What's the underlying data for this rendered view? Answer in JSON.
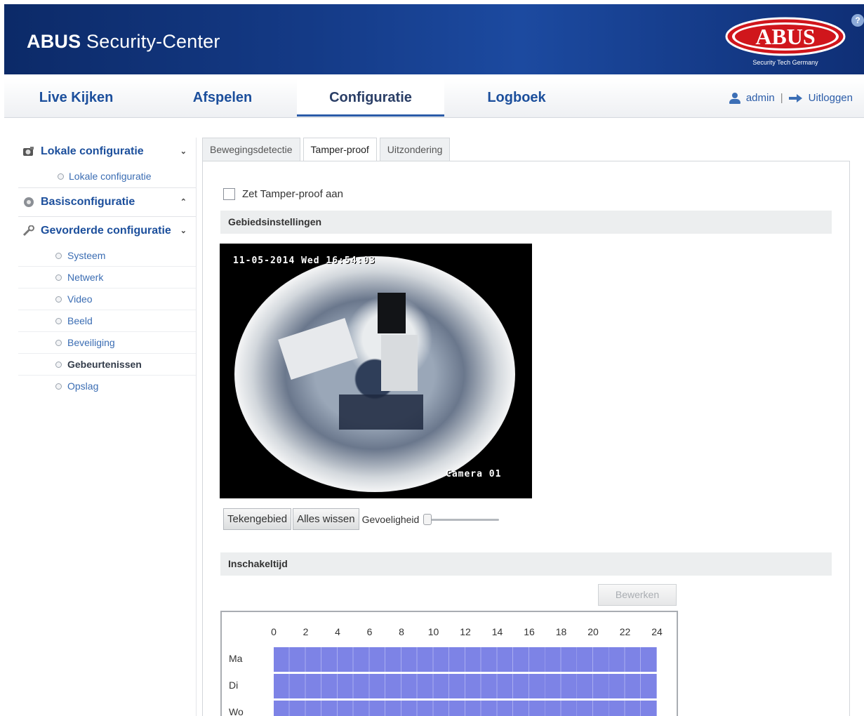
{
  "header": {
    "title_bold": "ABUS",
    "title_rest": " Security-Center",
    "logo_text": "ABUS",
    "logo_tagline": "Security Tech Germany",
    "help_label": "?"
  },
  "nav": {
    "tabs": [
      "Live Kijken",
      "Afspelen",
      "Configuratie",
      "Logboek"
    ],
    "active_tab": "Configuratie",
    "user": "admin",
    "separator": "|",
    "logout": "Uitloggen"
  },
  "sidebar": {
    "groups": [
      {
        "label": "Lokale configuratie",
        "chevron": "⌄",
        "items": [
          "Lokale configuratie"
        ]
      },
      {
        "label": "Basisconfiguratie",
        "chevron": "⌃",
        "items": []
      },
      {
        "label": "Gevorderde configuratie",
        "chevron": "⌄",
        "items": [
          "Systeem",
          "Netwerk",
          "Video",
          "Beeld",
          "Beveiliging",
          "Gebeurtenissen",
          "Opslag"
        ]
      }
    ],
    "active_item": "Gebeurtenissen"
  },
  "content": {
    "tabs": [
      "Bewegingsdetectie",
      "Tamper-proof",
      "Uitzondering"
    ],
    "active_tab": "Tamper-proof",
    "enable_checkbox": {
      "label": "Zet Tamper-proof aan",
      "checked": false
    },
    "area_section": "Gebiedsinstellingen",
    "video": {
      "timestamp": "11-05-2014 Wed 16:54:03",
      "camera_label": "Camera 01"
    },
    "buttons": {
      "draw": "Tekengebied",
      "clear": "Alles wissen"
    },
    "sensitivity": {
      "label": "Gevoeligheid",
      "value": 0
    },
    "schedule_section": "Inschakeltijd",
    "edit_button": "Bewerken",
    "schedule": {
      "hours": [
        "0",
        "2",
        "4",
        "6",
        "8",
        "10",
        "12",
        "14",
        "16",
        "18",
        "20",
        "22",
        "24"
      ],
      "days": [
        "Ma",
        "Di",
        "Wo"
      ],
      "color": "#7d83e6"
    }
  }
}
